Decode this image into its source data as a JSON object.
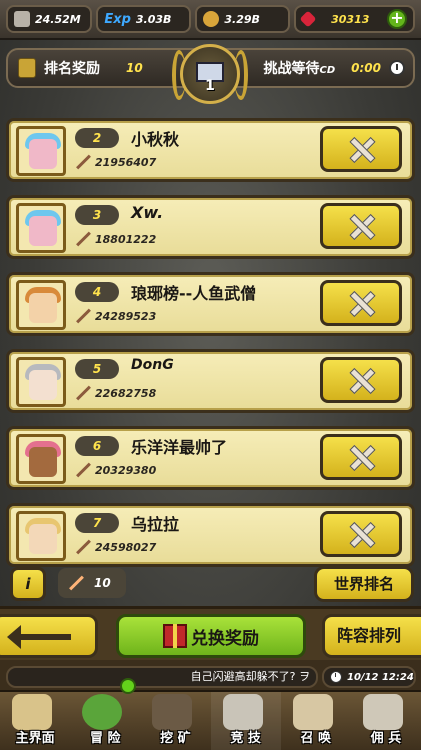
{
  "resources": {
    "attack": "24.52M",
    "exp_label": "Exp",
    "exp": "3.03B",
    "gold": "3.29B",
    "gems": "30313",
    "plus": "+"
  },
  "rank_bar": {
    "reward_label": "排名奖励",
    "reward_value": "10",
    "wait_label": "挑战等待",
    "wait_suffix": "CD",
    "wait_value": "0:00",
    "emblem_rank": "1"
  },
  "players": [
    {
      "rank": "2",
      "name": "小秋秋",
      "power": "21956407"
    },
    {
      "rank": "3",
      "name": "Xw.",
      "power": "18801222"
    },
    {
      "rank": "4",
      "name": "琅琊榜--人鱼武僧",
      "power": "24289523"
    },
    {
      "rank": "5",
      "name": "DonG",
      "power": "22682758"
    },
    {
      "rank": "6",
      "name": "乐洋洋最帅了",
      "power": "20329380"
    },
    {
      "rank": "7",
      "name": "乌拉拉",
      "power": "24598027"
    }
  ],
  "floating": {
    "info": "i",
    "fights_left": "10",
    "world_rank": "世界排名"
  },
  "actions": {
    "redeem": "兑换奖励",
    "lineup": "阵容排列"
  },
  "ticker": {
    "message": "自己闪避高却躲不了? ヲ",
    "time": "10/12 12:24"
  },
  "nav": [
    "主界面",
    "冒 险",
    "挖 矿",
    "竞 技",
    "召 唤",
    "佣 兵"
  ]
}
